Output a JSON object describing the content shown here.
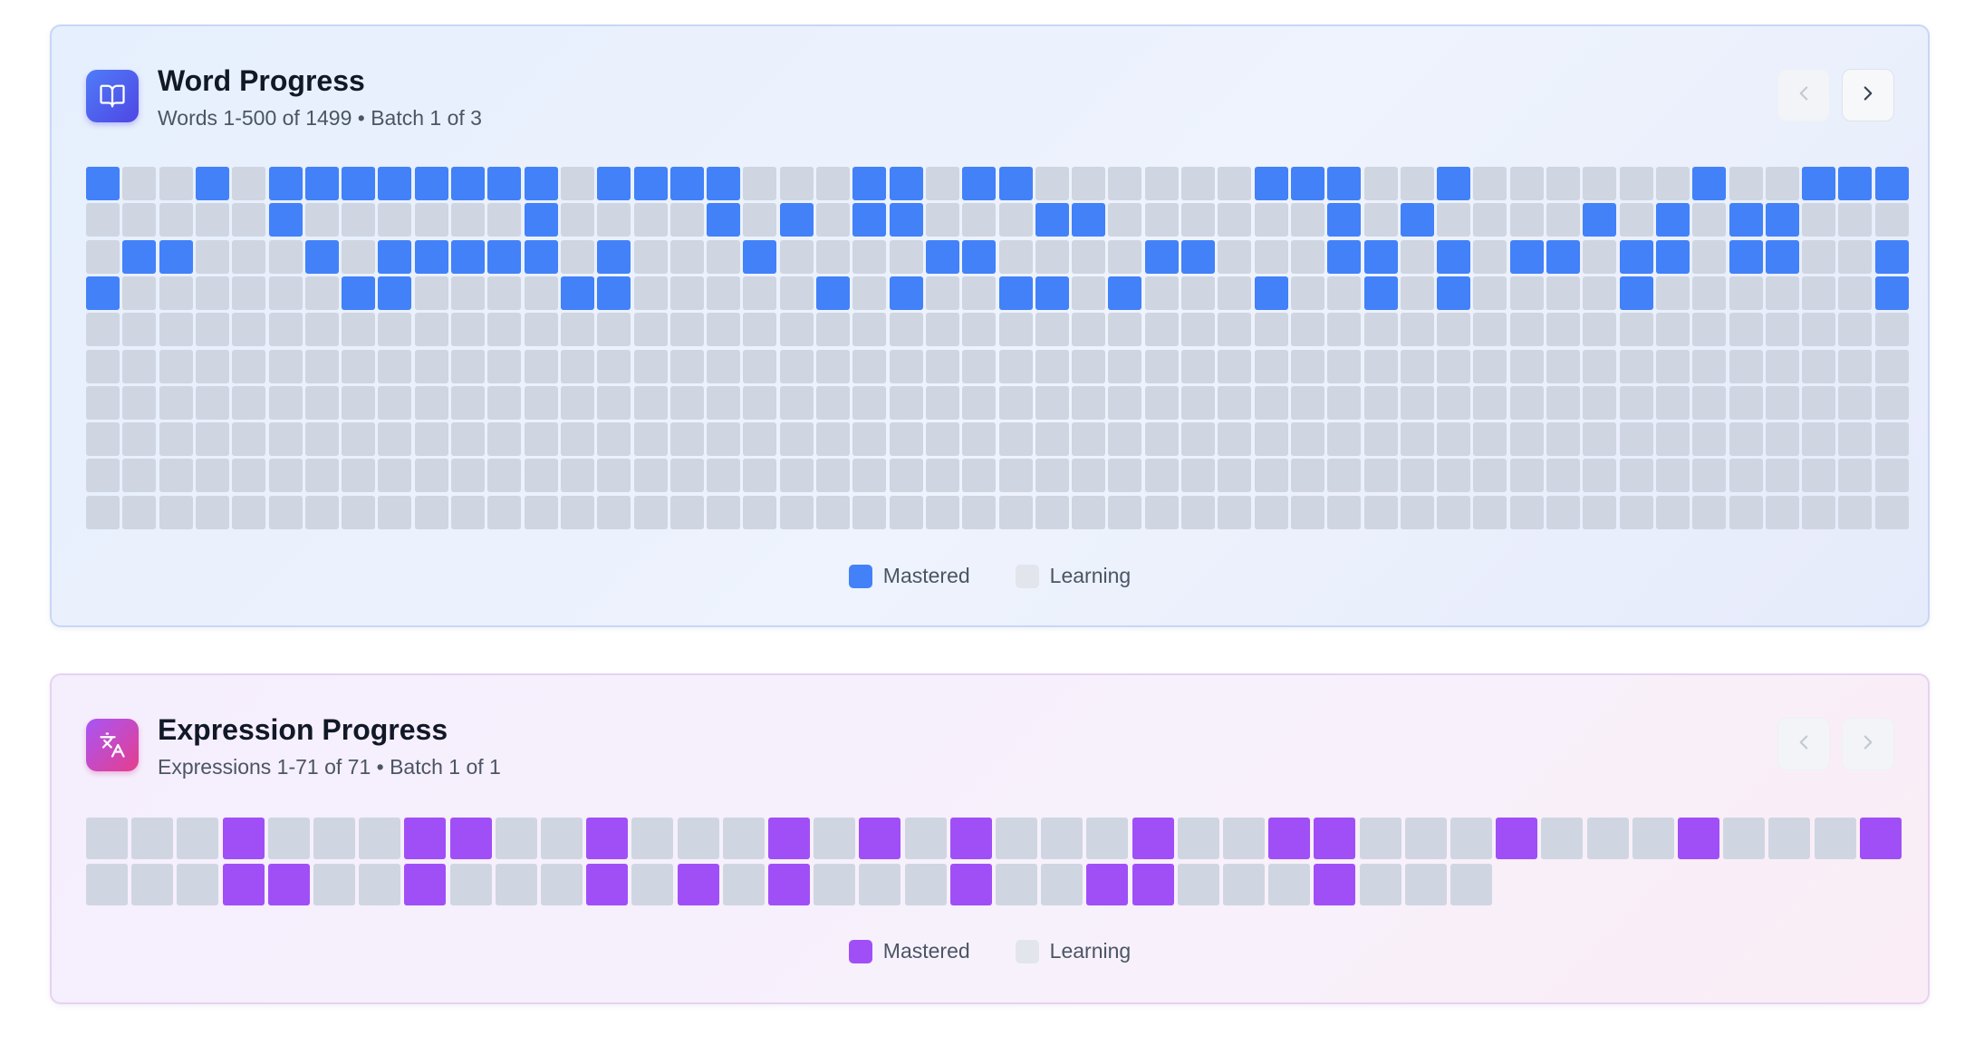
{
  "colors": {
    "word_mastered": "#4281f8",
    "expression_mastered": "#a04ff7",
    "learning": "#cfd6e2"
  },
  "word_progress": {
    "icon": "open-book-icon",
    "title": "Word Progress",
    "subtitle": "Words 1-500 of 1499 • Batch 1 of 3",
    "prev_enabled": false,
    "next_enabled": true,
    "columns": 50,
    "rows": [
      "10010111111110111100011011000000111001000000100111",
      "00000100000010000101011000110000001010000101011000",
      "01100010111110100010000110000110001101011011011001",
      "10000001100001100000101001101000100101000010000001",
      "00000000000000000000000000000000000000000000000000",
      "00000000000000000000000000000000000000000000000000",
      "00000000000000000000000000000000000000000000000000",
      "00000000000000000000000000000000000000000000000000",
      "00000000000000000000000000000000000000000000000000",
      "00000000000000000000000000000000000000000000000000"
    ],
    "legend": {
      "mastered": "Mastered",
      "learning": "Learning"
    }
  },
  "expression_progress": {
    "icon": "translate-icon",
    "title": "Expression Progress",
    "subtitle": "Expressions 1-71 of 71 • Batch 1 of 1",
    "prev_enabled": false,
    "next_enabled": false,
    "columns": 40,
    "rows": [
      "0001000110010001010100010011000100010001",
      "0001100100010101000100110001000"
    ],
    "legend": {
      "mastered": "Mastered",
      "learning": "Learning"
    }
  }
}
